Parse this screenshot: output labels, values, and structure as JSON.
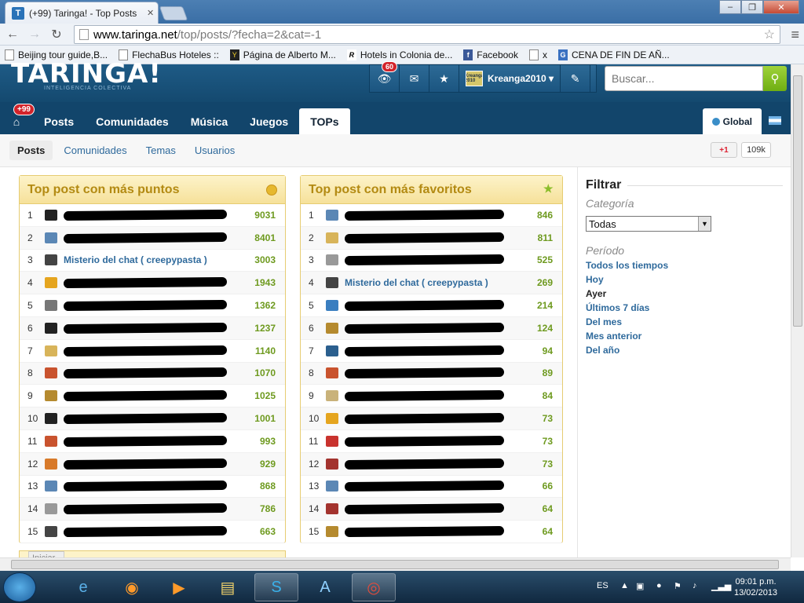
{
  "browser": {
    "tab_title": "(+99) Taringa! - Top Posts",
    "url_host": "www.taringa.net",
    "url_path": "/top/posts/?fecha=2&cat=-1",
    "bookmarks": [
      {
        "label": "Beijing tour guide,B...",
        "icon": "page-icon"
      },
      {
        "label": "FlechaBus Hoteles ::",
        "icon": "page-icon"
      },
      {
        "label": "Página de Alberto M...",
        "icon": "yahoo-icon"
      },
      {
        "label": "Hotels in Colonia de...",
        "icon": "r-icon"
      },
      {
        "label": "Facebook",
        "icon": "facebook-icon"
      },
      {
        "label": "x",
        "icon": "page-icon"
      },
      {
        "label": "CENA DE FIN DE AÑ...",
        "icon": "google-icon"
      }
    ]
  },
  "site": {
    "logo": "TARINGA!",
    "logo_sub": "INTELIGENCIA COLECTIVA",
    "notif_badge": "60",
    "username": "Kreanga2010",
    "avatar_text": "Kreanga 2010",
    "search_placeholder": "Buscar...",
    "home_badge": "+99",
    "nav": [
      "Posts",
      "Comunidades",
      "Música",
      "Juegos",
      "TOPs"
    ],
    "global_label": "Global",
    "subnav": [
      "Posts",
      "Comunidades",
      "Temas",
      "Usuarios"
    ],
    "gplus_label": "+1",
    "gplus_count": "109k"
  },
  "panels": {
    "puntos": {
      "title": "Top post con más puntos",
      "rows": [
        {
          "n": "1",
          "title": "",
          "value": "9031",
          "icon": "#222"
        },
        {
          "n": "2",
          "title": "",
          "value": "8401",
          "icon": "#5b87b5"
        },
        {
          "n": "3",
          "title": "Misterio del chat ( creepypasta )",
          "value": "3003",
          "icon": "#444"
        },
        {
          "n": "4",
          "title": "",
          "value": "1943",
          "icon": "#e5a51f"
        },
        {
          "n": "5",
          "title": "",
          "value": "1362",
          "icon": "#777"
        },
        {
          "n": "6",
          "title": "",
          "value": "1237",
          "icon": "#222"
        },
        {
          "n": "7",
          "title": "",
          "value": "1140",
          "icon": "#d8b45a"
        },
        {
          "n": "8",
          "title": "",
          "value": "1070",
          "icon": "#c9532e"
        },
        {
          "n": "9",
          "title": "",
          "value": "1025",
          "icon": "#b58a2f"
        },
        {
          "n": "10",
          "title": "",
          "value": "1001",
          "icon": "#222"
        },
        {
          "n": "11",
          "title": "",
          "value": "993",
          "icon": "#c9532e"
        },
        {
          "n": "12",
          "title": "",
          "value": "929",
          "icon": "#d87a2a"
        },
        {
          "n": "13",
          "title": "",
          "value": "868",
          "icon": "#5b87b5"
        },
        {
          "n": "14",
          "title": "",
          "value": "786",
          "icon": "#999"
        },
        {
          "n": "15",
          "title": "",
          "value": "663",
          "icon": "#444"
        }
      ]
    },
    "favoritos": {
      "title": "Top post con más favoritos",
      "rows": [
        {
          "n": "1",
          "title": "",
          "value": "846",
          "icon": "#5b87b5"
        },
        {
          "n": "2",
          "title": "",
          "value": "811",
          "icon": "#d8b45a"
        },
        {
          "n": "3",
          "title": "",
          "value": "525",
          "icon": "#999"
        },
        {
          "n": "4",
          "title": "Misterio del chat ( creepypasta )",
          "value": "269",
          "icon": "#444"
        },
        {
          "n": "5",
          "title": "",
          "value": "214",
          "icon": "#3a7ec0"
        },
        {
          "n": "6",
          "title": "",
          "value": "124",
          "icon": "#b58a2f"
        },
        {
          "n": "7",
          "title": "",
          "value": "94",
          "icon": "#2b5f8e"
        },
        {
          "n": "8",
          "title": "",
          "value": "89",
          "icon": "#c9532e"
        },
        {
          "n": "9",
          "title": "",
          "value": "84",
          "icon": "#c9b27a"
        },
        {
          "n": "10",
          "title": "",
          "value": "73",
          "icon": "#e5a51f"
        },
        {
          "n": "11",
          "title": "",
          "value": "73",
          "icon": "#c9332e"
        },
        {
          "n": "12",
          "title": "",
          "value": "73",
          "icon": "#a3332e"
        },
        {
          "n": "13",
          "title": "",
          "value": "66",
          "icon": "#5b87b5"
        },
        {
          "n": "14",
          "title": "",
          "value": "64",
          "icon": "#a3332e"
        },
        {
          "n": "15",
          "title": "",
          "value": "64",
          "icon": "#b58a2f"
        }
      ]
    },
    "next_tab": "Iniciar"
  },
  "sidebar": {
    "title": "Filtrar",
    "cat_label": "Categoría",
    "cat_value": "Todas",
    "period_label": "Período",
    "periods": [
      "Todos los tiempos",
      "Hoy",
      "Ayer",
      "Últimos 7 días",
      "Del mes",
      "Mes anterior",
      "Del año"
    ],
    "active_period": "Ayer"
  },
  "taskbar": {
    "lang": "ES",
    "time": "09:01 p.m.",
    "date": "13/02/2013"
  },
  "colors": {
    "header_blue": "#14496f",
    "panel_gold": "#b38a12",
    "value_green": "#6e9a1f",
    "link_blue": "#2f6a9c"
  }
}
